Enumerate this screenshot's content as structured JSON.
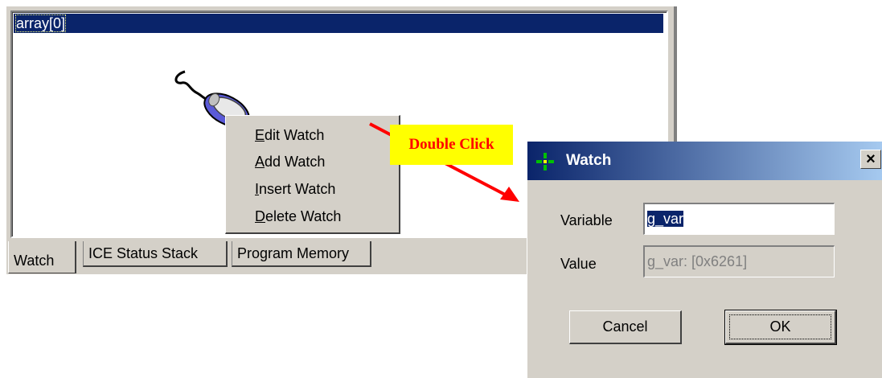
{
  "watch_window": {
    "list_items": [
      "array[0]"
    ],
    "tabs": [
      {
        "label": "Watch",
        "active": true
      },
      {
        "label": "ICE Status Stack",
        "active": false
      },
      {
        "label": "Program Memory",
        "active": false
      }
    ]
  },
  "context_menu": {
    "items": [
      {
        "mnemonic": "E",
        "rest": "dit Watch"
      },
      {
        "mnemonic": "A",
        "rest": "dd Watch"
      },
      {
        "mnemonic": "I",
        "rest": "nsert Watch"
      },
      {
        "mnemonic": "D",
        "rest": "elete Watch"
      }
    ]
  },
  "annotation": {
    "callout_text": "Double Click",
    "callout_bg": "#ffff00",
    "callout_color": "#ff0000",
    "arrow_color": "#ff0000"
  },
  "watch_dialog": {
    "title": "Watch",
    "close_glyph": "×",
    "variable_label": "Variable",
    "variable_value": "g_var",
    "value_label": "Value",
    "value_value": "g_var: [0x6261]",
    "cancel_label": "Cancel",
    "ok_label": "OK"
  },
  "colors": {
    "selection": "#0a246a",
    "face": "#d4d0c8",
    "title_gradient_start": "#0a246a",
    "title_gradient_end": "#a6caf0"
  }
}
